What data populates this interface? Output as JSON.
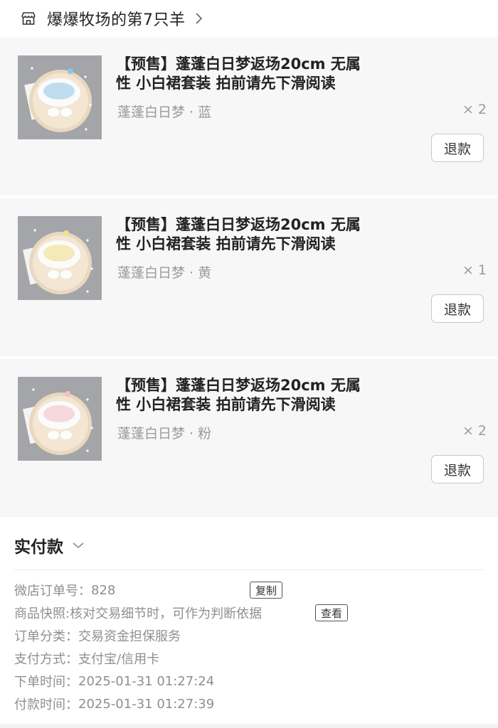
{
  "shop": {
    "name": "爆爆牧场的第7只羊",
    "icon": "store-icon",
    "arrow_icon": "chevron-right-icon"
  },
  "items": [
    {
      "title": "【预售】蓬蓬白日梦返场20cm 无属性 小白裙套装 拍前请先下滑阅读",
      "variant": "蓬蓬白日梦 · 蓝",
      "qty": "× 2",
      "refund_label": "退款",
      "accent": "#8cc4ea"
    },
    {
      "title": "【预售】蓬蓬白日梦返场20cm 无属性 小白裙套装 拍前请先下滑阅读",
      "variant": "蓬蓬白日梦 · 黄",
      "qty": "× 1",
      "refund_label": "退款",
      "accent": "#f2e08a"
    },
    {
      "title": "【预售】蓬蓬白日梦返场20cm 无属性 小白裙套装 拍前请先下滑阅读",
      "variant": "蓬蓬白日梦 · 粉",
      "qty": "× 2",
      "refund_label": "退款",
      "accent": "#f3c0c8"
    }
  ],
  "payment": {
    "title": "实付款",
    "toggle_icon": "chevron-down-icon"
  },
  "order_info": {
    "order_number": {
      "label": "微店订单号：",
      "value": "828",
      "copy_label": "复制"
    },
    "snapshot": {
      "label": "商品快照: ",
      "value": "核对交易细节时，可作为判断依据",
      "view_label": "查看"
    },
    "category": {
      "label": "订单分类：",
      "value": "交易资金担保服务"
    },
    "pay_method": {
      "label": "支付方式：",
      "value": "支付宝/信用卡"
    },
    "order_time": {
      "label": "下单时间：",
      "value": "2025-01-31 01:27:24"
    },
    "pay_time": {
      "label": "付款时间：",
      "value": "2025-01-31 01:27:39"
    }
  }
}
